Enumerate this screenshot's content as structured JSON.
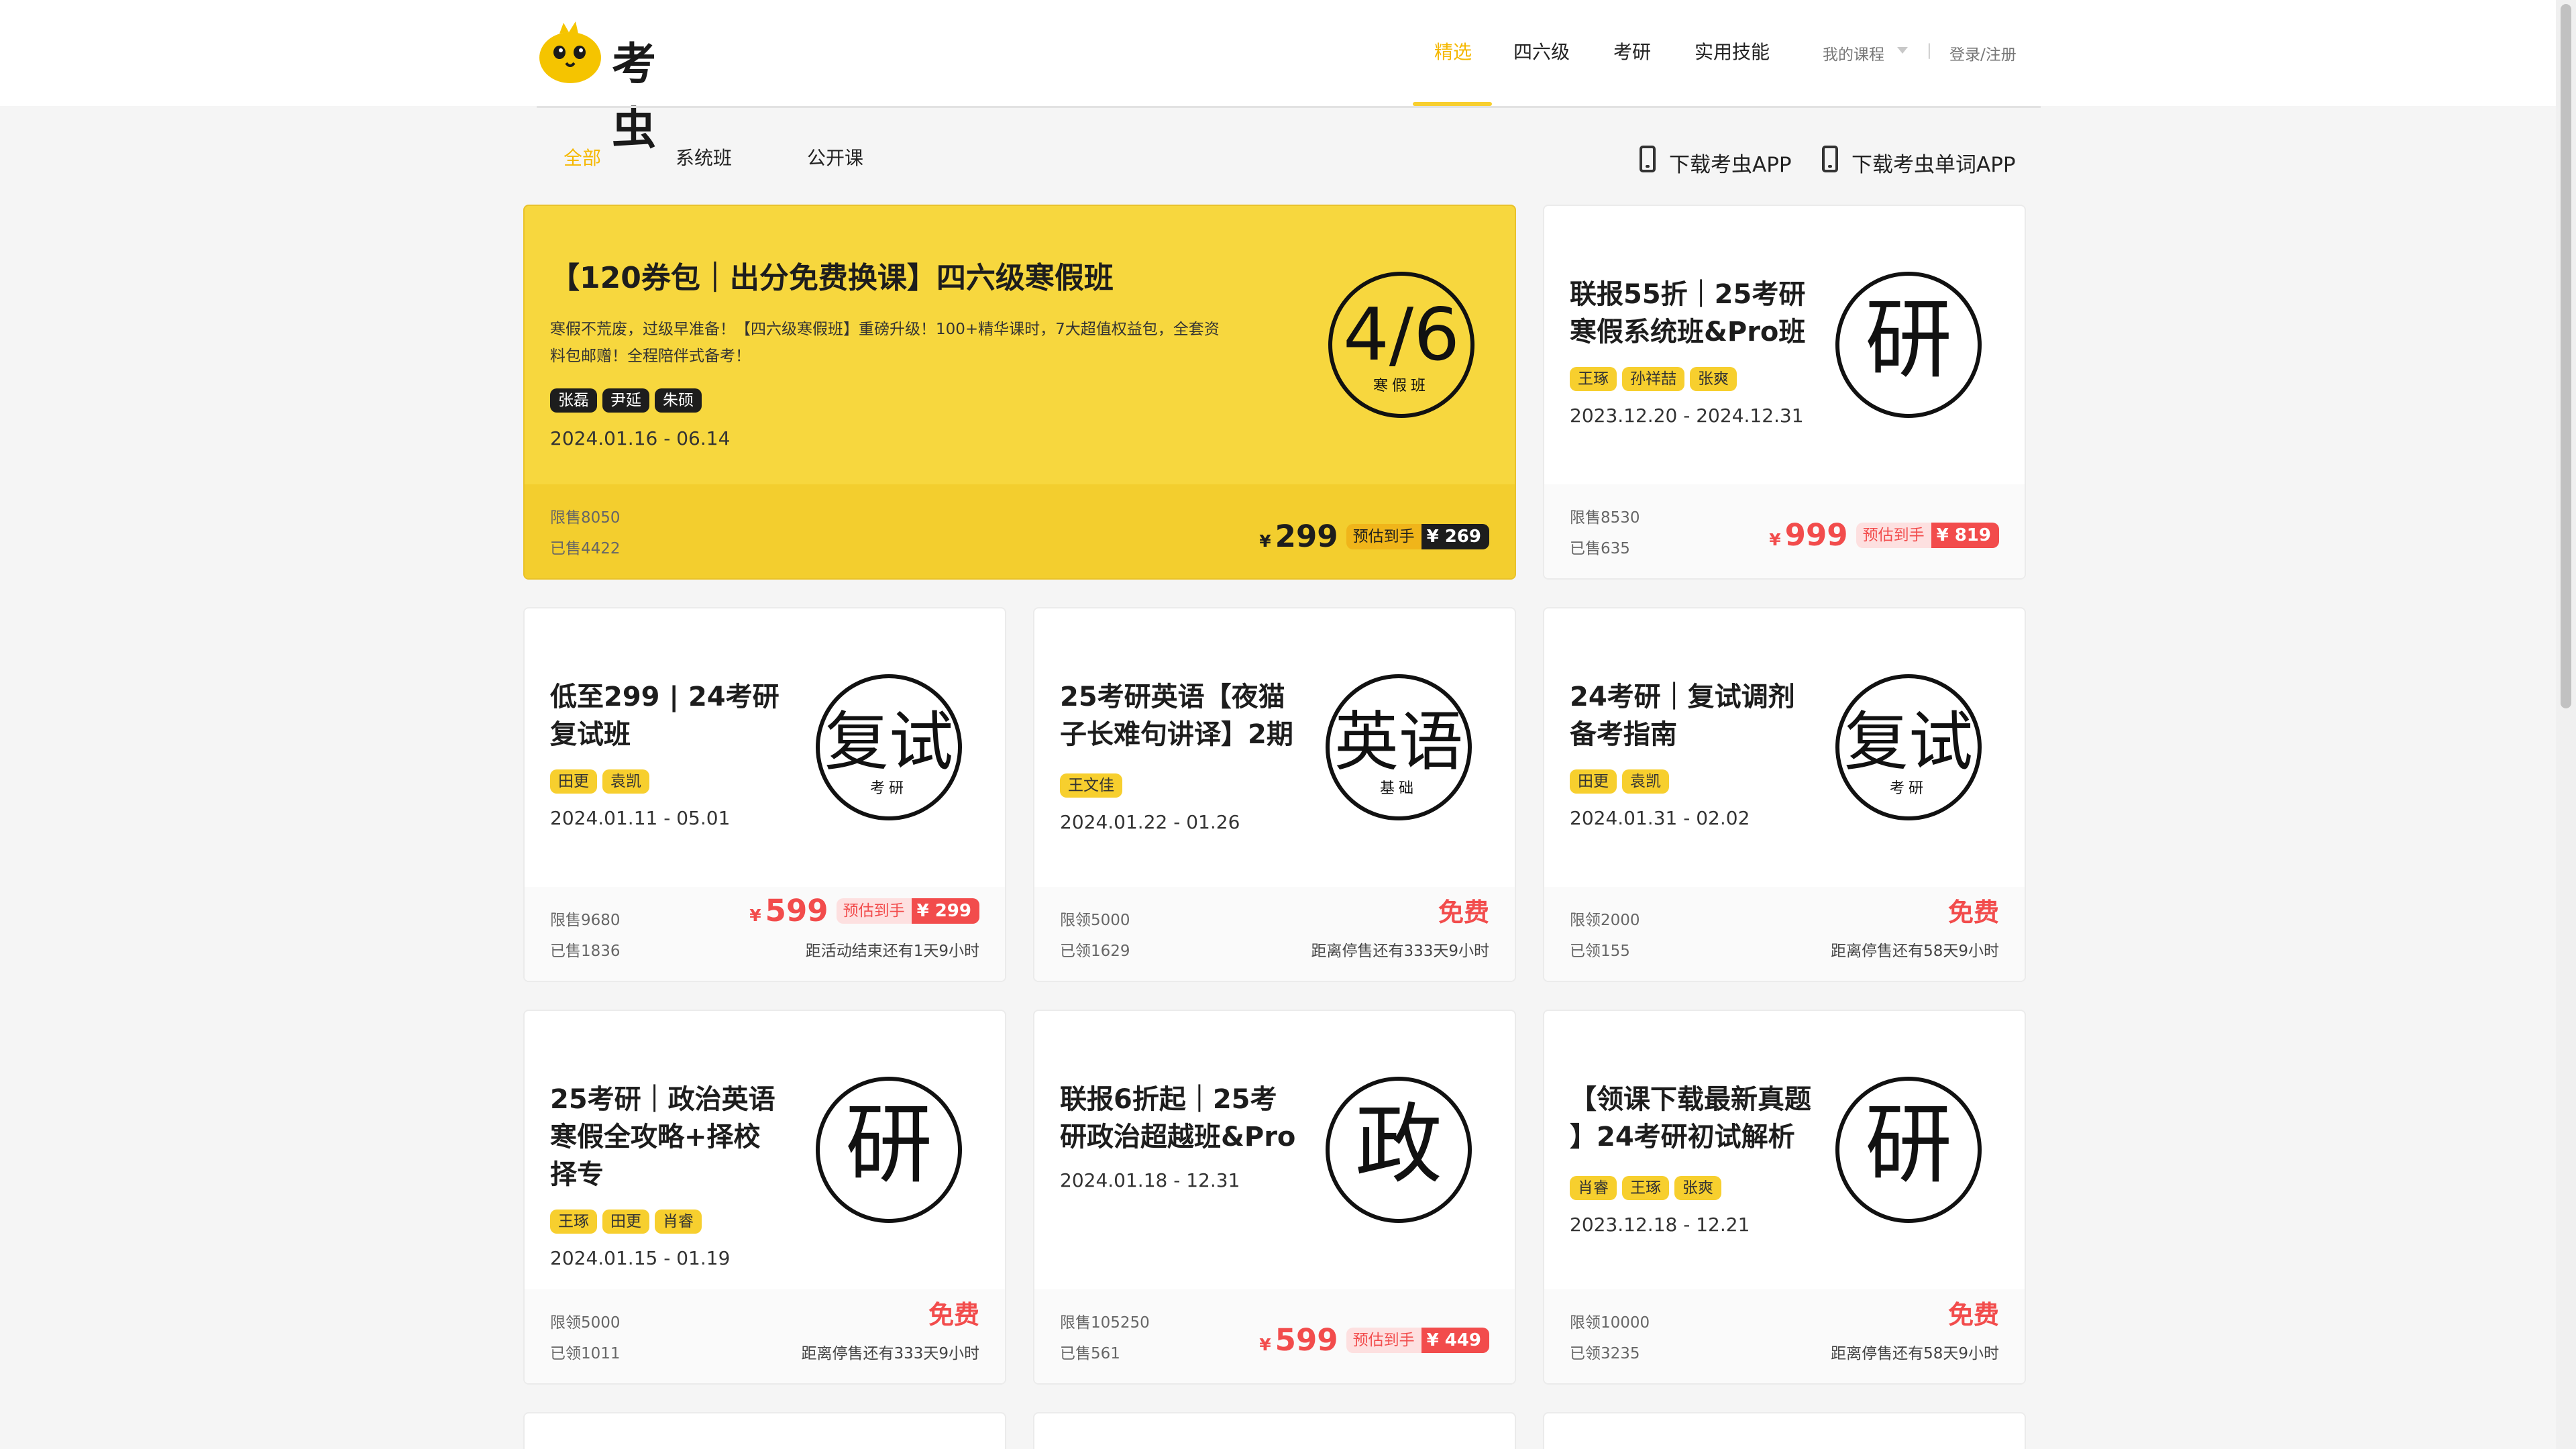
{
  "header": {
    "logo_text": "考虫",
    "nav": [
      "精选",
      "四六级",
      "考研",
      "实用技能"
    ],
    "my_courses": "我的课程",
    "separator": "|",
    "login": "登录/注册"
  },
  "subnav": {
    "filters": [
      "全部",
      "系统班",
      "公开课"
    ],
    "app_links": [
      "下载考虫APP",
      "下载考虫单词APP"
    ]
  },
  "cards": [
    {
      "title": "【120券包｜出分免费换课】四六级寒假班",
      "desc_line1": "寒假不荒废，过级早准备！【四六级寒假班】重磅升级！100+精华课时，7大超值权益包，全套资",
      "desc_line2": "料包邮赠！全程陪伴式备考！",
      "tags": [
        "张磊",
        "尹延",
        "朱硕"
      ],
      "date": "2024.01.16 - 06.14",
      "badge_main": "4/6",
      "badge_sub": "寒假班",
      "stat1": "限售8050",
      "stat2": "已售4422",
      "currency": "¥",
      "price": "299",
      "est_label": "预估到手",
      "est_value": "¥ 269"
    },
    {
      "title_line1": "联报55折｜25考研",
      "title_line2": "寒假系统班&Pro班",
      "tags": [
        "王琢",
        "孙祥喆",
        "张爽"
      ],
      "date": "2023.12.20 - 2024.12.31",
      "badge_main": "研",
      "stat1": "限售8530",
      "stat2": "已售635",
      "currency": "¥",
      "price": "999",
      "est_label": "预估到手",
      "est_value": "¥ 819"
    },
    {
      "title_line1": "低至299 | 24考研",
      "title_line2": "复试班",
      "tags": [
        "田更",
        "袁凯"
      ],
      "date": "2024.01.11 - 05.01",
      "badge_main": "复试",
      "badge_sub": "考研",
      "stat1": "限售9680",
      "stat2": "已售1836",
      "currency": "¥",
      "price": "599",
      "est_label": "预估到手",
      "est_value": "¥ 299",
      "countdown": "距活动结束还有1天9小时"
    },
    {
      "title_line1": "25考研英语【夜猫",
      "title_line2": "子长难句讲译】2期",
      "tags": [
        "王文佳"
      ],
      "date": "2024.01.22 - 01.26",
      "badge_main": "英语",
      "badge_sub": "基础",
      "stat1": "限领5000",
      "stat2": "已领1629",
      "free": "免费",
      "countdown": "距离停售还有333天9小时"
    },
    {
      "title_line1": "24考研｜复试调剂",
      "title_line2": "备考指南",
      "tags": [
        "田更",
        "袁凯"
      ],
      "date": "2024.01.31 - 02.02",
      "badge_main": "复试",
      "badge_sub": "考研",
      "stat1": "限领2000",
      "stat2": "已领155",
      "free": "免费",
      "countdown": "距离停售还有58天9小时"
    },
    {
      "title_line1": "25考研｜政治英语",
      "title_line2": "寒假全攻略+择校",
      "title_line3": "择专",
      "tags": [
        "王琢",
        "田更",
        "肖睿"
      ],
      "date": "2024.01.15 - 01.19",
      "badge_main": "研",
      "stat1": "限领5000",
      "stat2": "已领1011",
      "free": "免费",
      "countdown": "距离停售还有333天9小时"
    },
    {
      "title_line1": "联报6折起｜25考",
      "title_line2": "研政治超越班&Pro",
      "date": "2024.01.18 - 12.31",
      "badge_main": "政",
      "stat1": "限售105250",
      "stat2": "已售561",
      "currency": "¥",
      "price": "599",
      "est_label": "预估到手",
      "est_value": "¥ 449"
    },
    {
      "title_line1": "【领课下载最新真题",
      "title_line2": "】24考研初试解析",
      "tags": [
        "肖睿",
        "王琢",
        "张爽"
      ],
      "date": "2023.12.18 - 12.21",
      "badge_main": "研",
      "stat1": "限领10000",
      "stat2": "已领3235",
      "free": "免费",
      "countdown": "距离停售还有58天9小时"
    }
  ]
}
